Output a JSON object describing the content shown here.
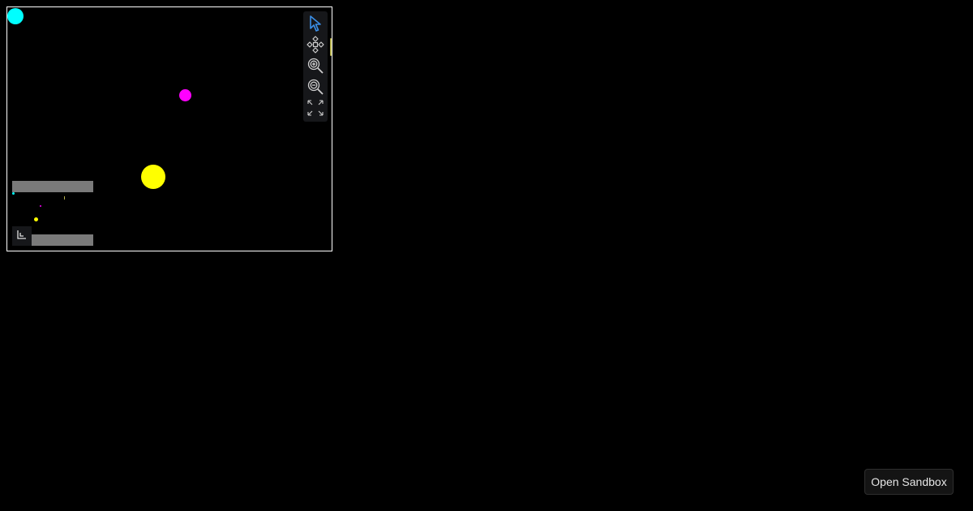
{
  "canvas": {
    "nodes": [
      {
        "name": "cyan-node",
        "color": "#00ffff"
      },
      {
        "name": "magenta-node",
        "color": "#ff00ff"
      },
      {
        "name": "yellow-node",
        "color": "#ffff00"
      }
    ],
    "edge_color": "#b5b04a"
  },
  "toolbar": {
    "tools": [
      {
        "icon": "pointer-icon",
        "active": true,
        "color": "#3a8ee6"
      },
      {
        "icon": "pan-icon",
        "active": false
      },
      {
        "icon": "zoom-in-icon",
        "active": false
      },
      {
        "icon": "zoom-out-icon",
        "active": false
      },
      {
        "icon": "fit-view-icon",
        "active": false
      }
    ]
  },
  "minimap": {
    "toggle_icon": "minimap-collapse-icon"
  },
  "open_sandbox": {
    "label": "Open Sandbox"
  }
}
